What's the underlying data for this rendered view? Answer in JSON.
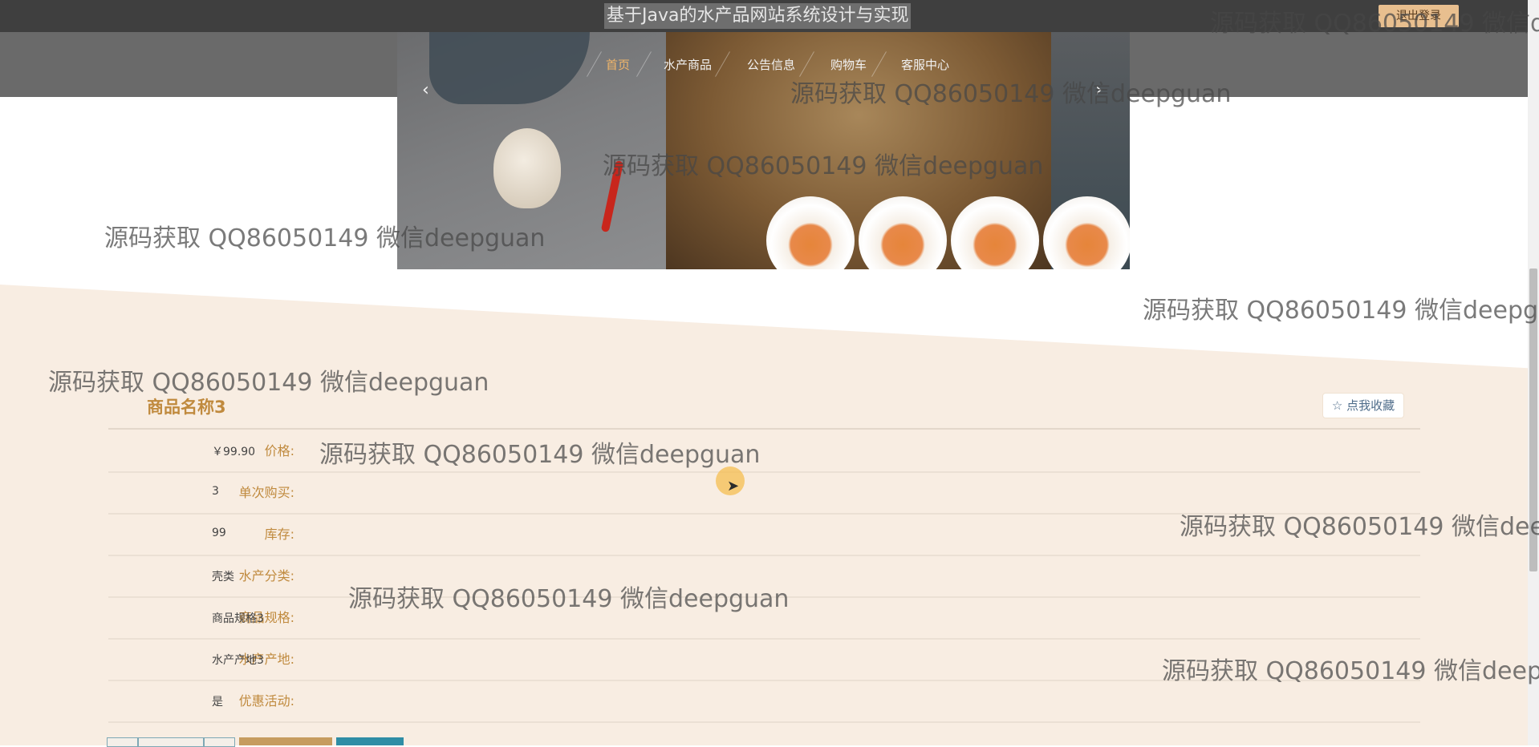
{
  "site_title": "基于Java的水产品网站系统设计与实现",
  "login_label": "退出登录",
  "nav": [
    {
      "label": "首页",
      "active": true
    },
    {
      "label": "水产商品",
      "active": false
    },
    {
      "label": "公告信息",
      "active": false
    },
    {
      "label": "购物车",
      "active": false
    },
    {
      "label": "客服中心",
      "active": false
    }
  ],
  "banner": {
    "prev_arrow": "‹",
    "next_arrow": "›"
  },
  "product": {
    "title": "商品名称3",
    "favorite_label": "☆ 点我收藏",
    "fields": [
      {
        "label": "价格:",
        "value": "￥99.90"
      },
      {
        "label": "单次购买:",
        "value": "3"
      },
      {
        "label": "库存:",
        "value": "99"
      },
      {
        "label": "水产分类:",
        "value": "壳类"
      },
      {
        "label": "商品规格:",
        "value": "商品规格3"
      },
      {
        "label": "水产产地:",
        "value": "水产产地3"
      },
      {
        "label": "优惠活动:",
        "value": "是"
      }
    ]
  },
  "watermark": "源码获取 QQ86050149 微信deepguan",
  "colors": {
    "accent": "#c08a3e",
    "topbar": "#3f3f3f",
    "detail_bg": "#f8ede2",
    "cart_button": "#2f8da5"
  }
}
